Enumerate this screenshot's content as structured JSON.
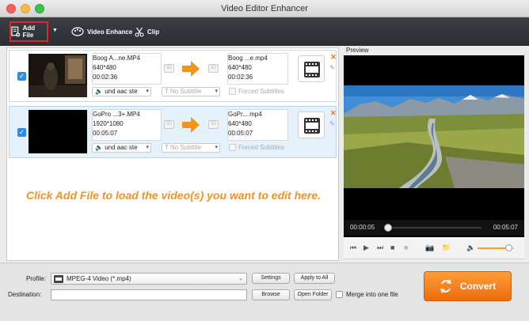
{
  "window": {
    "title": "Video Editor Enhancer"
  },
  "toolbar": {
    "add_file": "Add File",
    "video_enhance": "Video Enhance",
    "clip": "Clip"
  },
  "files": [
    {
      "source_name": "Boog A...ne.MP4",
      "source_resolution": "640*480",
      "source_duration": "00:02:36",
      "output_name": "Boog ...e.mp4",
      "output_resolution": "640*480",
      "output_duration": "00:02:36",
      "tag_3d": "3D",
      "audio": "und aac ste",
      "subtitle": "No Subtitle",
      "forced": "Forced Subtitles",
      "checked": true
    },
    {
      "source_name": "GoPro ...3+.MP4",
      "source_resolution": "1920*1080",
      "source_duration": "00:05:07",
      "output_name": "GoPr....mp4",
      "output_resolution": "640*480",
      "output_duration": "00:05:07",
      "tag_3d": "3D",
      "audio": "und aac ste",
      "subtitle": "No Subtitle",
      "forced": "Forced Subtitles",
      "checked": true
    }
  ],
  "hint": "Click Add File to load the video(s) you want to edit here.",
  "preview": {
    "label": "Preview",
    "current_time": "00:00:05",
    "total_time": "00:05:07",
    "progress": 0.02,
    "volume": 0.85
  },
  "bottom": {
    "profile_label": "Profile:",
    "profile_value": "MPEG-4 Video (*.mp4)",
    "settings": "Settings",
    "apply_all": "Apply to All",
    "destination_label": "Destination:",
    "destination_value": "",
    "browse": "Browse",
    "open_folder": "Open Folder",
    "merge": "Merge into one file",
    "convert": "Convert"
  },
  "colors": {
    "accent": "#f29420",
    "convert": "#f07a18",
    "toolbar": "#2f3338"
  }
}
